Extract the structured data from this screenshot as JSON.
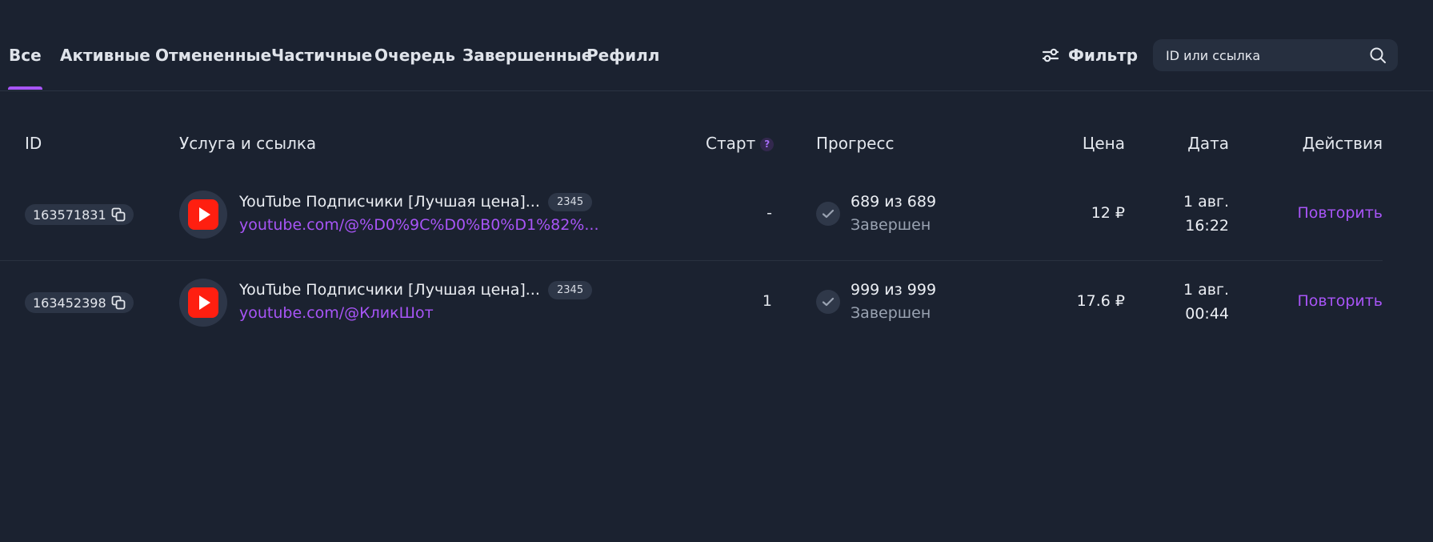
{
  "tabs": [
    "Все",
    "Активные",
    "Отмененные",
    "Частичные",
    "Очередь",
    "Завершенные",
    "Рефилл"
  ],
  "active_tab": "Все",
  "filter": {
    "label": "Фильтр",
    "icon": "sliders-icon"
  },
  "search": {
    "placeholder": "ID или ссылка",
    "value": "",
    "icon": "search-icon"
  },
  "table": {
    "columns": {
      "id": "ID",
      "service": "Услуга и ссылка",
      "start": "Старт",
      "start_help": "?",
      "progress": "Прогресс",
      "price": "Цена",
      "date": "Дата",
      "actions": "Действия"
    },
    "rows": [
      {
        "id": "163571831",
        "service_icon": "youtube-icon",
        "service_name": "YouTube Подписчики [Лучшая цена]...",
        "service_code": "2345",
        "link": "youtube.com/@%D0%9C%D0%B0%D1%82%...",
        "start": "-",
        "progress_count": "689 из 689",
        "progress_status": "Завершен",
        "price": "12 ₽",
        "date_day": "1 авг.",
        "date_time": "16:22",
        "action": "Повторить"
      },
      {
        "id": "163452398",
        "service_icon": "youtube-icon",
        "service_name": "YouTube Подписчики [Лучшая цена]...",
        "service_code": "2345",
        "link": "youtube.com/@КликШот",
        "start": "1",
        "progress_count": "999 из 999",
        "progress_status": "Завершен",
        "price": "17.6 ₽",
        "date_day": "1 авг.",
        "date_time": "00:44",
        "action": "Повторить"
      }
    ]
  },
  "colors": {
    "background": "#1b2230",
    "accent": "#a855f7",
    "youtube": "#ff1f10",
    "muted_text": "#9aa3b2"
  }
}
